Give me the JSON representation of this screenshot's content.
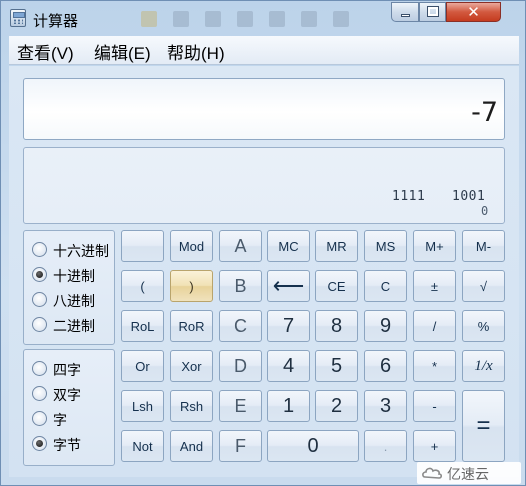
{
  "window": {
    "title": "计算器"
  },
  "menu": {
    "items": [
      "查看(V)",
      "编辑(E)",
      "帮助(H)"
    ]
  },
  "display": {
    "value": "-7"
  },
  "bits": {
    "group_a": "1111",
    "group_b": "1001",
    "position": "0"
  },
  "base_radio": {
    "options": [
      "十六进制",
      "十进制",
      "八进制",
      "二进制"
    ],
    "selected": "十进制"
  },
  "word_radio": {
    "options": [
      "四字",
      "双字",
      "字",
      "字节"
    ],
    "selected": "字节"
  },
  "keys": {
    "blank": "",
    "mod": "Mod",
    "a": "A",
    "mc": "MC",
    "mr": "MR",
    "ms": "MS",
    "mplus": "M+",
    "mminus": "M-",
    "lparen": "(",
    "rparen": ")",
    "b": "B",
    "backspace": "⟵",
    "ce": "CE",
    "c": "C",
    "plusminus": "±",
    "sqrt": "√",
    "rol": "RoL",
    "ror": "RoR",
    "c_hex": "C",
    "seven": "7",
    "eight": "8",
    "nine": "9",
    "divide": "/",
    "percent": "%",
    "or": "Or",
    "xor": "Xor",
    "d": "D",
    "four": "4",
    "five": "5",
    "six": "6",
    "multiply": "*",
    "reciprocal": "1/x",
    "lsh": "Lsh",
    "rsh": "Rsh",
    "e": "E",
    "one": "1",
    "two": "2",
    "three": "3",
    "minus": "-",
    "equals": "=",
    "not": "Not",
    "and": "And",
    "f": "F",
    "zero": "0",
    "decimal": ".",
    "plus": "+"
  },
  "watermark": {
    "text": "亿速云"
  },
  "colors": {
    "accent": "#c53b1f",
    "chrome": "#c7dbef",
    "pressed": "#f1e2b6"
  }
}
